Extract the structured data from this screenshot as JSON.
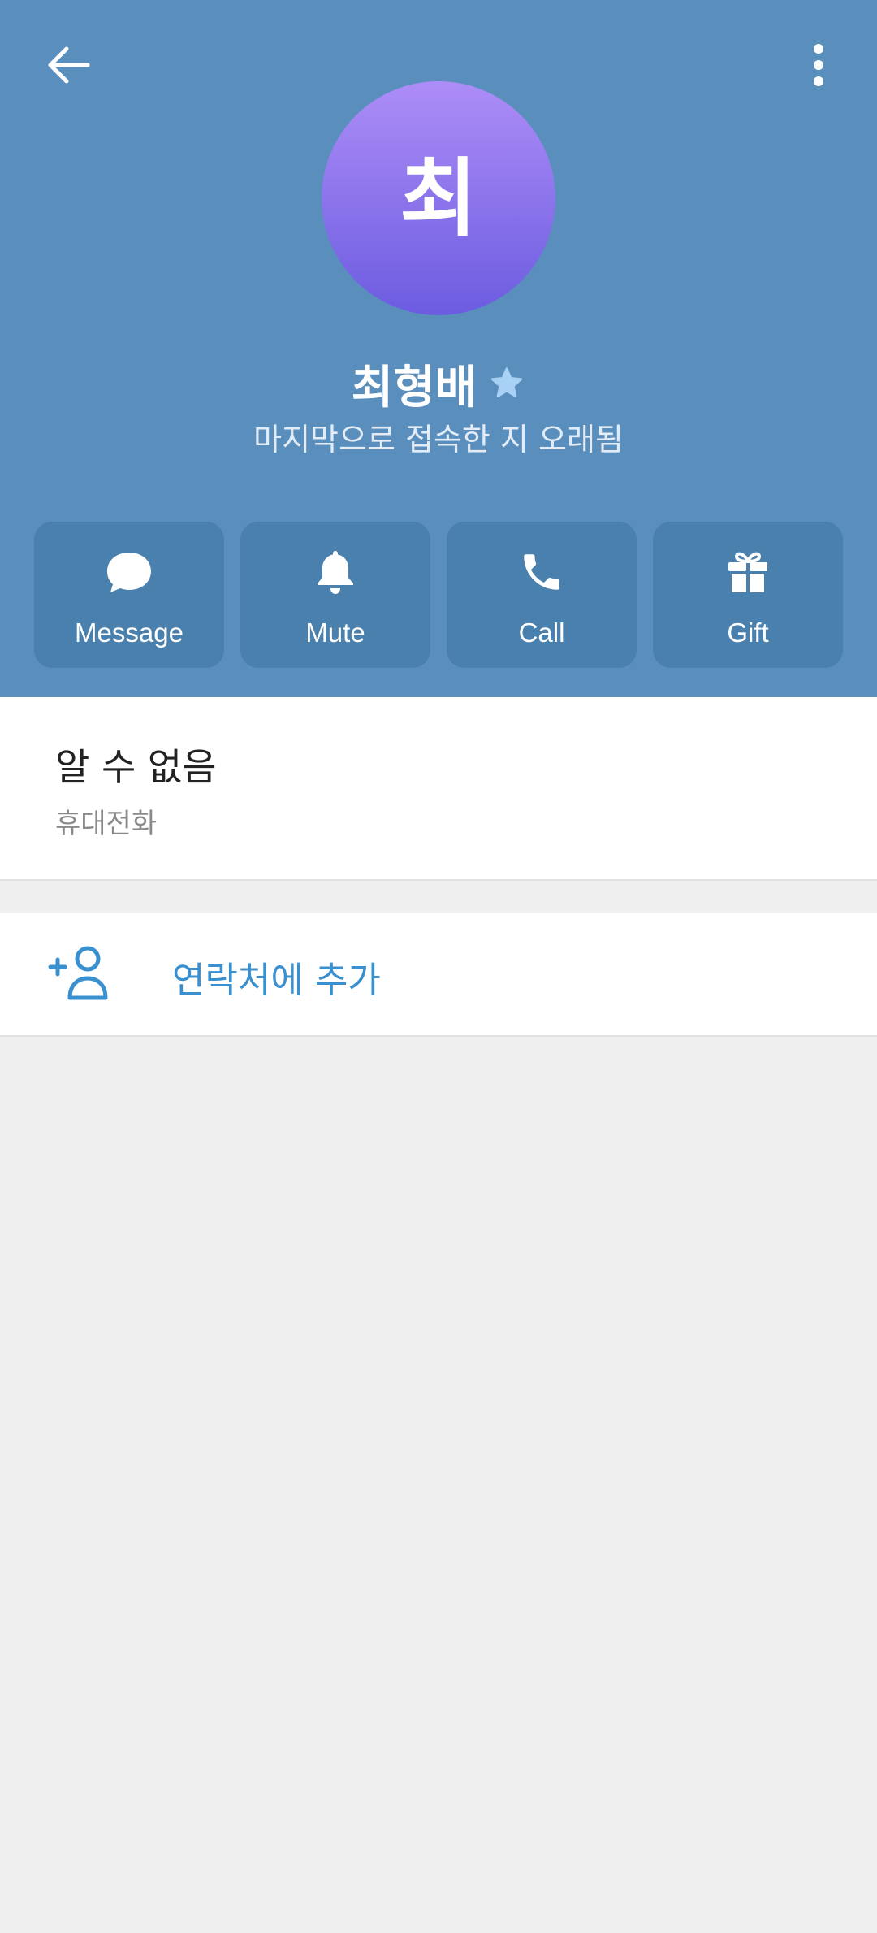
{
  "header": {
    "avatar_initial": "최",
    "name": "최형배",
    "status": "마지막으로 접속한 지 오래됨"
  },
  "actions": [
    {
      "label": "Message",
      "icon": "chat-bubble-icon"
    },
    {
      "label": "Mute",
      "icon": "bell-icon"
    },
    {
      "label": "Call",
      "icon": "phone-icon"
    },
    {
      "label": "Gift",
      "icon": "gift-icon"
    }
  ],
  "info": {
    "phone_value": "알 수 없음",
    "phone_label": "휴대전화"
  },
  "add_contact": {
    "label": "연락처에 추가",
    "icon": "add-person-icon"
  },
  "colors": {
    "header_bg": "#5a8fbd",
    "action_bg": "#4a80ad",
    "accent": "#3a8fcf",
    "page_bg": "#efefef"
  }
}
